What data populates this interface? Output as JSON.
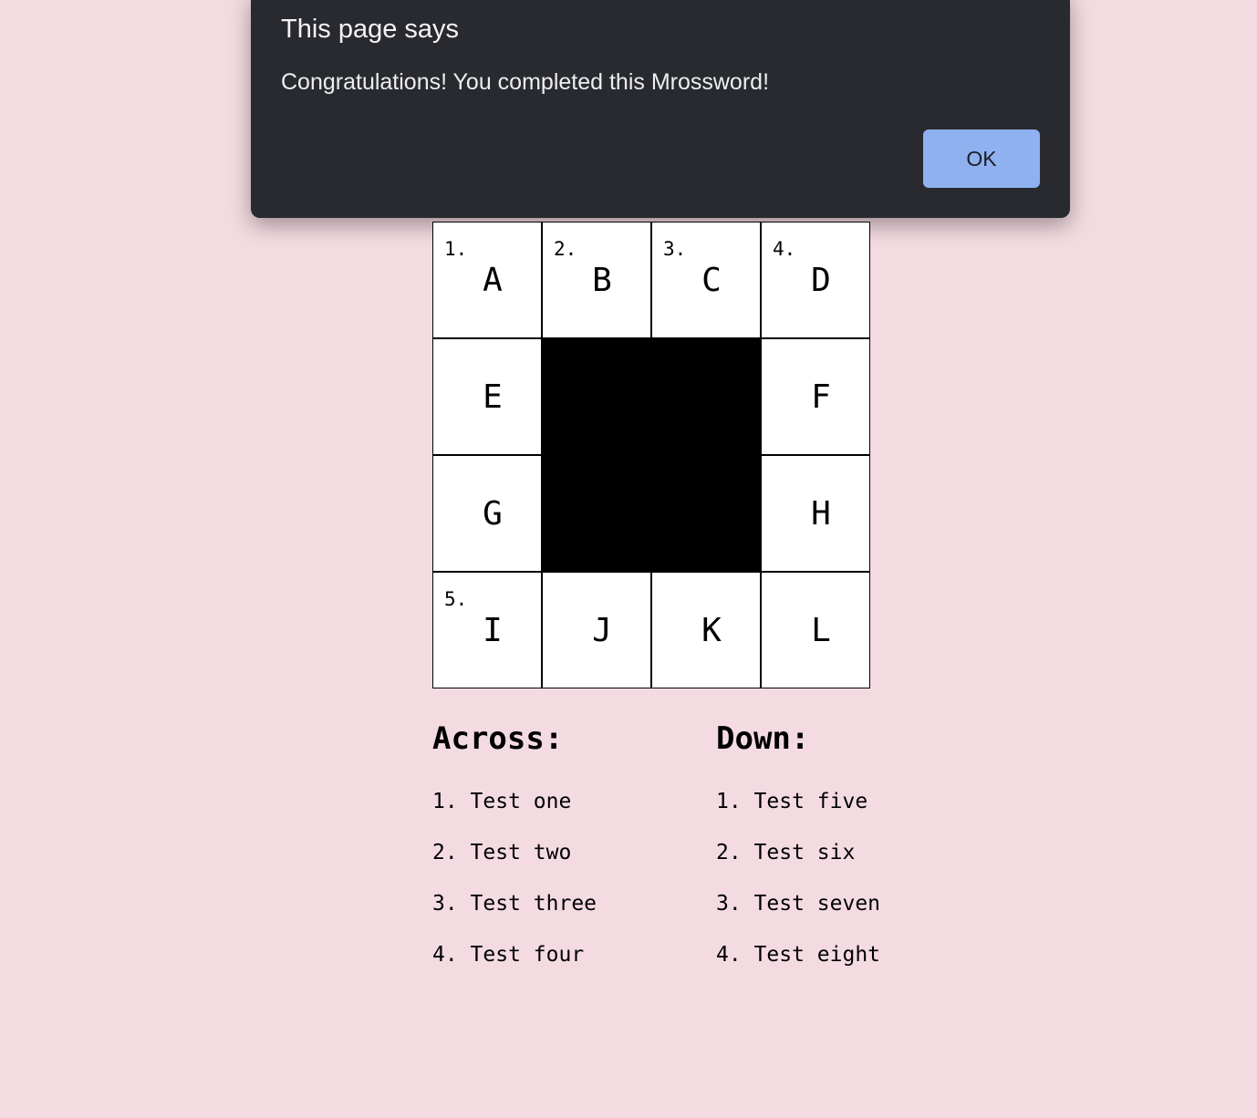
{
  "dialog": {
    "title": "This page says",
    "message": "Congratulations! You completed this Mrossword!",
    "ok_label": "OK"
  },
  "grid": {
    "rows": [
      [
        {
          "num": "1.",
          "letter": "A"
        },
        {
          "num": "2.",
          "letter": "B"
        },
        {
          "num": "3.",
          "letter": "C"
        },
        {
          "num": "4.",
          "letter": "D"
        }
      ],
      [
        {
          "num": "",
          "letter": "E"
        },
        {
          "block": true
        },
        {
          "block": true
        },
        {
          "num": "",
          "letter": "F"
        }
      ],
      [
        {
          "num": "",
          "letter": "G"
        },
        {
          "block": true
        },
        {
          "block": true
        },
        {
          "num": "",
          "letter": "H"
        }
      ],
      [
        {
          "num": "5.",
          "letter": "I"
        },
        {
          "num": "",
          "letter": "J"
        },
        {
          "num": "",
          "letter": "K"
        },
        {
          "num": "",
          "letter": "L"
        }
      ]
    ]
  },
  "clues": {
    "across": {
      "title": "Across:",
      "items": [
        "1. Test one",
        "2. Test two",
        "3. Test three",
        "4. Test four"
      ]
    },
    "down": {
      "title": "Down:",
      "items": [
        "1. Test five",
        "2. Test six",
        "3. Test seven",
        "4. Test eight"
      ]
    }
  }
}
